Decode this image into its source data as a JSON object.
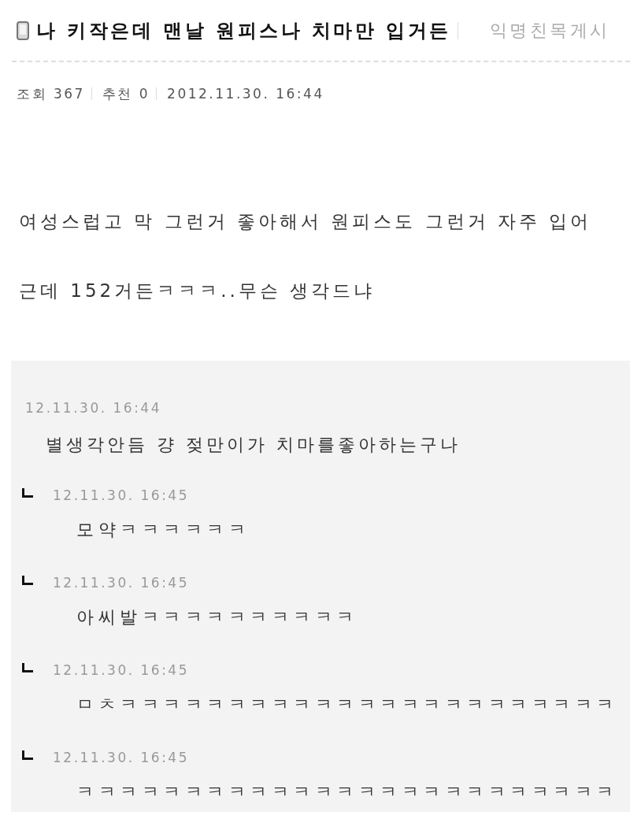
{
  "post": {
    "title": "나 키작은데 맨날 원피스나 치마만 입거든",
    "board": "익명친목게시",
    "stats": [
      {
        "label": "조회",
        "value": "367"
      },
      {
        "label": "추천",
        "value": "0"
      }
    ],
    "date": "2012.11.30. 16:44",
    "body": [
      "여성스럽고 막 그런거 좋아해서 원피스도 그런거 자주 입어",
      "근데 152거든ㅋㅋㅋ..무슨 생각드냐"
    ]
  },
  "comments": [
    {
      "date": "12.11.30. 16:44",
      "text": "별생각안듬 걍 젖만이가 치마를좋아하는구나",
      "children": [
        {
          "date": "12.11.30. 16:45",
          "text": "모약ㅋㅋㅋㅋㅋㅋ"
        },
        {
          "date": "12.11.30. 16:45",
          "text": "아씨발ㅋㅋㅋㅋㅋㅋㅋㅋㅋㅋ"
        },
        {
          "date": "12.11.30. 16:45",
          "text": "ㅁㅊㅋㅋㅋㅋㅋㅋㅋㅋㅋㅋㅋㅋㅋㅋㅋㅋㅋㅋㅋㅋㅋㅋㅋ"
        },
        {
          "date": "12.11.30. 16:45",
          "text": "ㅋㅋㅋㅋㅋㅋㅋㅋㅋㅋㅋㅋㅋㅋㅋㅋㅋㅋㅋㅋㅋㅋㅋㅋㅋ"
        }
      ]
    }
  ]
}
